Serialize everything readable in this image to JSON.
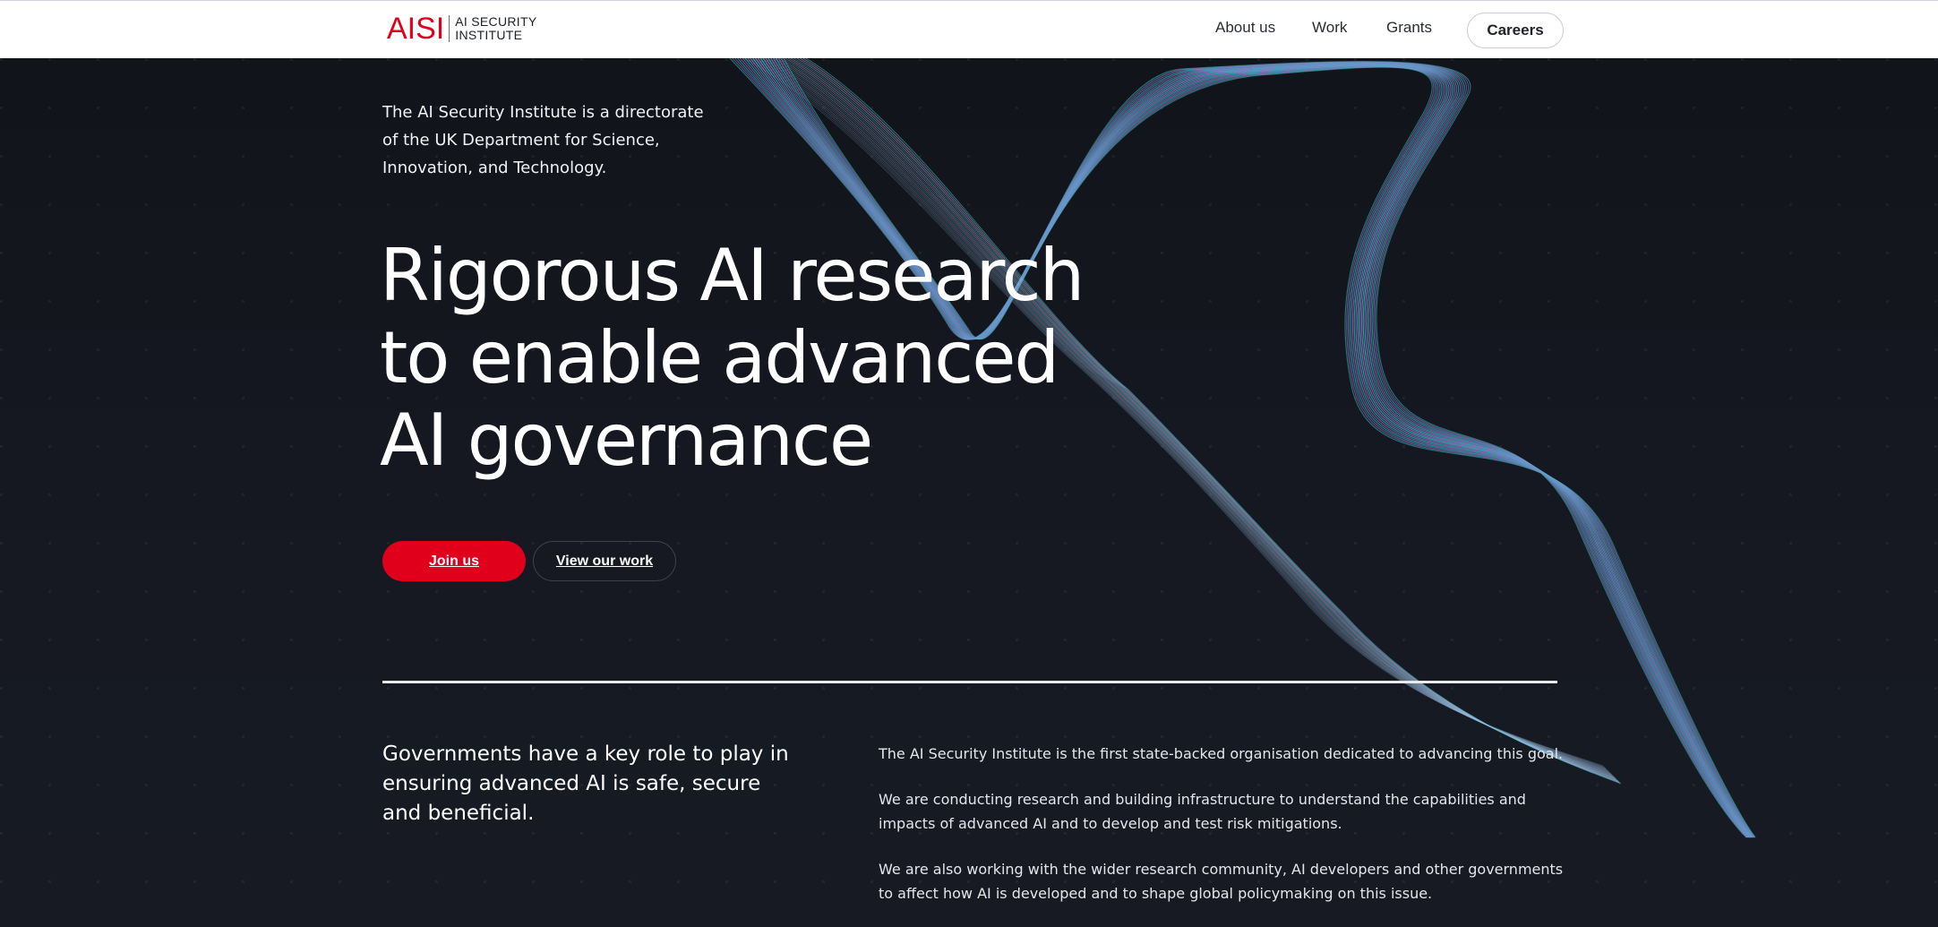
{
  "header": {
    "logo_mark": "AISI",
    "logo_text_line1": "AI SECURITY",
    "logo_text_line2": "INSTITUTE",
    "nav": {
      "about": "About us",
      "work": "Work",
      "grants": "Grants",
      "careers": "Careers"
    }
  },
  "hero": {
    "intro": "The AI Security Institute is a directorate of the UK Department for Science, Innovation, and Technology.",
    "headline_line1": "Rigorous AI research",
    "headline_line2": "to enable advanced",
    "headline_line3": "AI governance",
    "join_button": "Join us",
    "work_button": "View our work"
  },
  "about": {
    "lead": "Governments have a key role to play in ensuring advanced AI is safe, secure and beneficial.",
    "p1": "The AI Security Institute is the first state-backed organisation dedicated to advancing this goal.",
    "p2": "We are conducting research and building infrastructure to understand the capabilities and impacts of advanced AI and to develop and test risk mitigations.",
    "p3": "We are also working with the wider research community, AI developers and other governments to affect how AI is developed and to shape global policymaking on this issue."
  },
  "colors": {
    "accent": "#e1001c",
    "background": "#14161e",
    "wave_teal": "#2fc7b7",
    "wave_purple": "#8a7fd6"
  }
}
